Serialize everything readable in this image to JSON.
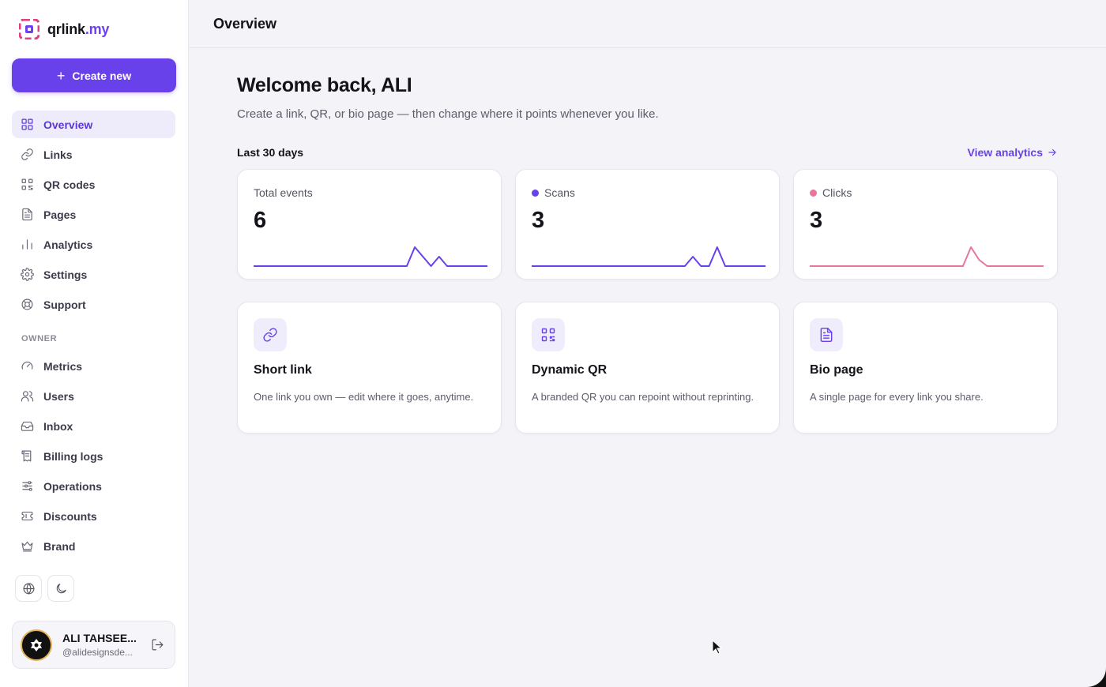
{
  "brand": {
    "name": "qrlink",
    "tld": ".my"
  },
  "sidebar": {
    "create_label": "Create new",
    "items": [
      {
        "label": "Overview",
        "icon": "grid-icon",
        "active": true
      },
      {
        "label": "Links",
        "icon": "link-icon"
      },
      {
        "label": "QR codes",
        "icon": "qr-icon"
      },
      {
        "label": "Pages",
        "icon": "file-text-icon"
      },
      {
        "label": "Analytics",
        "icon": "bar-chart-icon"
      },
      {
        "label": "Settings",
        "icon": "gear-icon"
      },
      {
        "label": "Support",
        "icon": "life-buoy-icon"
      }
    ],
    "owner_label": "OWNER",
    "owner_items": [
      {
        "label": "Metrics",
        "icon": "gauge-icon"
      },
      {
        "label": "Users",
        "icon": "users-icon"
      },
      {
        "label": "Inbox",
        "icon": "inbox-icon"
      },
      {
        "label": "Billing logs",
        "icon": "receipt-icon"
      },
      {
        "label": "Operations",
        "icon": "sliders-icon"
      },
      {
        "label": "Discounts",
        "icon": "ticket-icon"
      },
      {
        "label": "Brand",
        "icon": "crown-icon"
      }
    ]
  },
  "user": {
    "name": "ALI TAHSEE...",
    "handle": "@alidesignsde..."
  },
  "header": {
    "title": "Overview"
  },
  "main": {
    "welcome": "Welcome back, ALI",
    "subtitle": "Create a link, QR, or bio page — then change where it points whenever you like.",
    "range_label": "Last 30 days",
    "view_analytics": "View analytics",
    "stats": [
      {
        "label": "Total events",
        "value": "6",
        "color": "#6941ea",
        "dot": false,
        "series": [
          0,
          0,
          0,
          0,
          0,
          0,
          0,
          0,
          0,
          0,
          0,
          0,
          0,
          0,
          0,
          0,
          0,
          0,
          0,
          0,
          2,
          1,
          0,
          1,
          0,
          0,
          0,
          0,
          0,
          0
        ]
      },
      {
        "label": "Scans",
        "value": "3",
        "color": "#6941ea",
        "dot": true,
        "series": [
          0,
          0,
          0,
          0,
          0,
          0,
          0,
          0,
          0,
          0,
          0,
          0,
          0,
          0,
          0,
          0,
          0,
          0,
          0,
          0,
          1,
          0,
          0,
          2,
          0,
          0,
          0,
          0,
          0,
          0
        ]
      },
      {
        "label": "Clicks",
        "value": "3",
        "color": "#e8759e",
        "dot": true,
        "series": [
          0,
          0,
          0,
          0,
          0,
          0,
          0,
          0,
          0,
          0,
          0,
          0,
          0,
          0,
          0,
          0,
          0,
          0,
          0,
          0,
          3,
          1,
          0,
          0,
          0,
          0,
          0,
          0,
          0,
          0
        ]
      }
    ],
    "features": [
      {
        "title": "Short link",
        "desc": "One link you own — edit where it goes, anytime.",
        "icon": "link-icon"
      },
      {
        "title": "Dynamic QR",
        "desc": "A branded QR you can repoint without reprinting.",
        "icon": "qr-icon"
      },
      {
        "title": "Bio page",
        "desc": "A single page for every link you share.",
        "icon": "file-text-icon"
      }
    ]
  }
}
